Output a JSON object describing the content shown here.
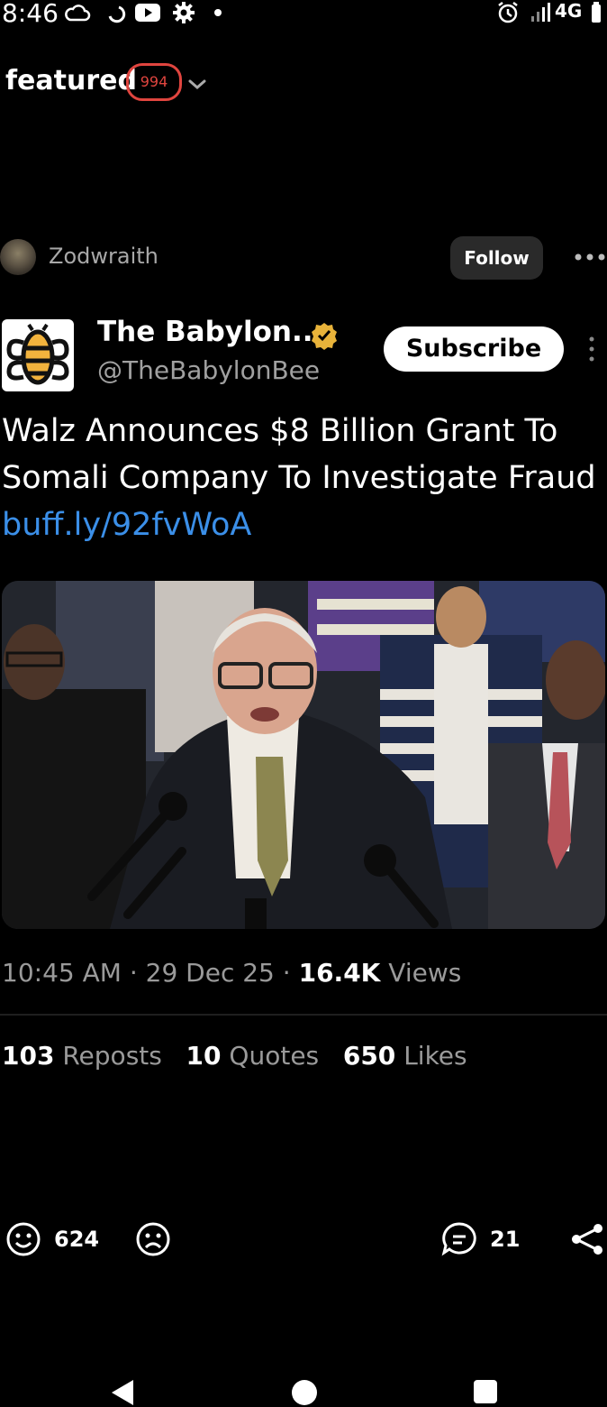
{
  "status_bar": {
    "time": "8:46",
    "network": "4G",
    "icons": [
      "cloud-icon",
      "refresh-icon",
      "youtube-icon",
      "gear-icon",
      "dot-icon",
      "alarm-icon",
      "signal-icon",
      "battery-icon"
    ]
  },
  "header": {
    "feed_label": "featured",
    "badge_count": "994",
    "badge_color": "#e0453f"
  },
  "poster": {
    "name": "Zodwraith",
    "follow_label": "Follow"
  },
  "embedded_tweet": {
    "account_name": "The Babylon...",
    "handle": "@TheBabylonBee",
    "subscribe_label": "Subscribe",
    "text": "Walz Announces $8 Billion Grant To Somali Company To Investigate Fraud",
    "link": "buff.ly/92fvWoA",
    "link_color": "#3b8fe8",
    "meta": {
      "time": "10:45 AM",
      "separator": "·",
      "date": "29 Dec 25",
      "views_count": "16.4K",
      "views_label": "Views"
    },
    "stats": {
      "reposts_count": "103",
      "reposts_label": "Reposts",
      "quotes_count": "10",
      "quotes_label": "Quotes",
      "likes_count": "650",
      "likes_label": "Likes"
    }
  },
  "reactions": {
    "smile_count": "624",
    "comments_count": "21"
  },
  "nav": {
    "icons": [
      "back-icon",
      "home-icon",
      "recents-icon"
    ]
  }
}
